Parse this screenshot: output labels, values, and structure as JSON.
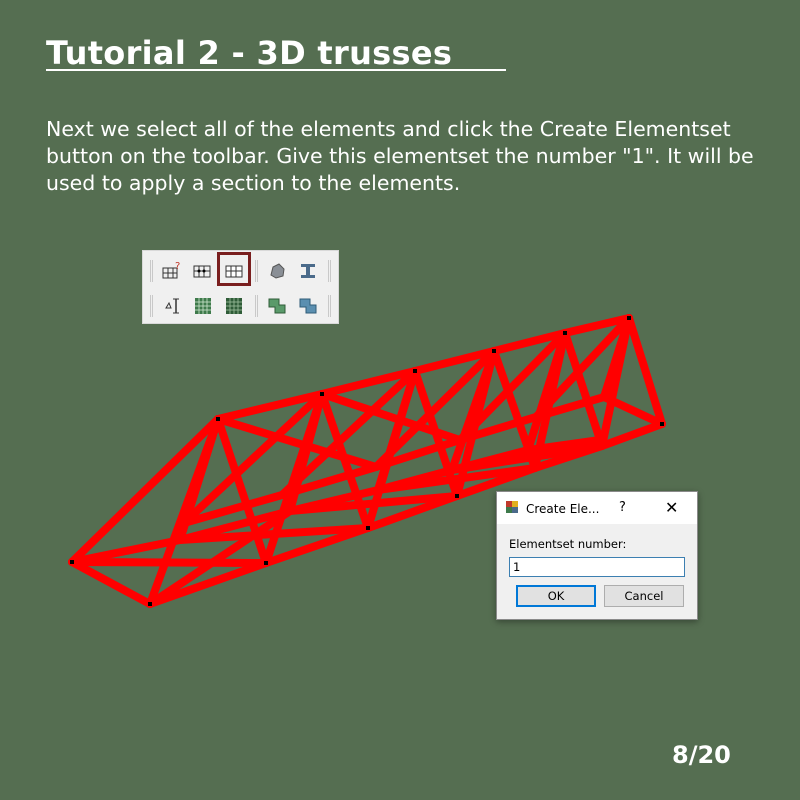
{
  "slide": {
    "title": "Tutorial 2 - 3D trusses",
    "body": "Next we select all of the elements and click the Create Elementset button on the toolbar. Give this elementset the number \"1\". It will be used to apply a section to the elements.",
    "page": "8/20"
  },
  "toolbar": {
    "row1": [
      "create-node-icon",
      "node-grid-icon",
      "create-elementset-icon",
      "rock-shape-icon",
      "beam-section-icon"
    ],
    "row2": [
      "dimension-icon",
      "mesh-green-icon",
      "mesh-dark-icon",
      "shape-green-icon",
      "shape-blue-icon"
    ],
    "highlighted": "create-elementset-icon"
  },
  "dialog": {
    "title": "Create Ele...",
    "help": "?",
    "close": "✕",
    "label": "Elementset number:",
    "value": "1",
    "ok": "OK",
    "cancel": "Cancel"
  },
  "colors": {
    "background": "#556e51",
    "truss": "#ff0000",
    "highlight": "#7a1f1f"
  }
}
